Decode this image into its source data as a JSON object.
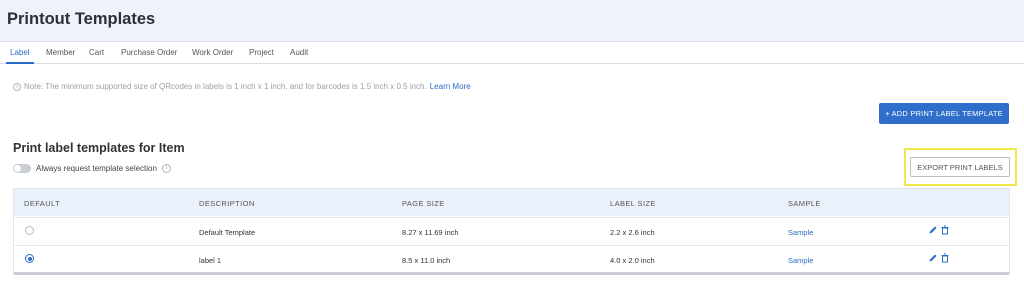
{
  "header": {
    "title": "Printout Templates"
  },
  "tabs": [
    {
      "label": "Label",
      "active": true
    },
    {
      "label": "Member",
      "active": false
    },
    {
      "label": "Cart",
      "active": false
    },
    {
      "label": "Purchase Order",
      "active": false
    },
    {
      "label": "Work Order",
      "active": false
    },
    {
      "label": "Project",
      "active": false
    },
    {
      "label": "Audit",
      "active": false
    }
  ],
  "note": {
    "icon": "info-icon",
    "text": "Note: The minimum supported size of QRcodes in labels is 1 inch x 1 inch, and for barcodes is 1.5 inch x 0.5 inch.",
    "link": "Learn More"
  },
  "add_button": {
    "label": "+ ADD PRINT LABEL TEMPLATE"
  },
  "section": {
    "title": "Print label templates for Item",
    "toggle_label": "Always request template selection",
    "toggle_on": false
  },
  "export_button": {
    "label": "EXPORT PRINT LABELS"
  },
  "table": {
    "columns": [
      "DEFAULT",
      "DESCRIPTION",
      "PAGE SIZE",
      "LABEL SIZE",
      "SAMPLE"
    ],
    "rows": [
      {
        "default": false,
        "description": "Default Template",
        "page_size": "8.27 x 11.69 inch",
        "label_size": "2.2 x 2.6 inch",
        "sample": "Sample"
      },
      {
        "default": true,
        "description": "label 1",
        "page_size": "8.5 x 11.0 inch",
        "label_size": "4.0 x 2.0 inch",
        "sample": "Sample"
      }
    ]
  },
  "colors": {
    "accent": "#2f6fcb",
    "highlight": "#f0ea48",
    "header_bg": "#eef3fb"
  }
}
